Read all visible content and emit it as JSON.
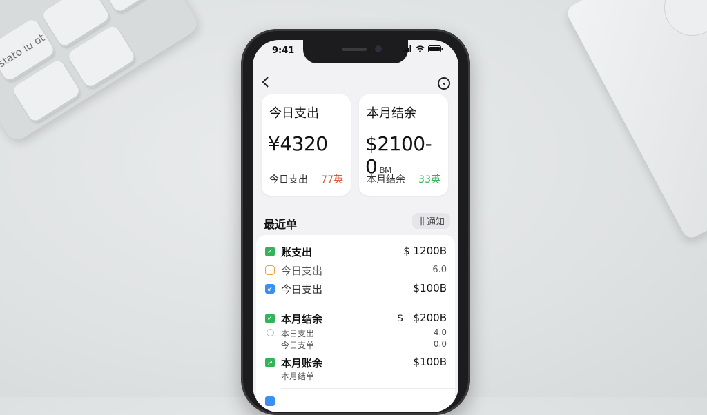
{
  "background": {
    "keyboard_keys": [
      "stato iu ot",
      "",
      ""
    ]
  },
  "status_bar": {
    "time": "9:41"
  },
  "header": {
    "back_icon": "chevron-left-icon",
    "more_icon": "more-circle-icon"
  },
  "cards": [
    {
      "label": "今日支出",
      "amount": "¥4320",
      "amount_suffix": "",
      "sub_label": "今日支出",
      "delta": "77英",
      "delta_color": "#e0573f"
    },
    {
      "label": "本月结余",
      "amount": "$2100-0",
      "amount_suffix": "BM",
      "sub_label": "本月结余",
      "delta": "33英",
      "delta_color": "#34b45a"
    }
  ],
  "recent": {
    "title": "最近单",
    "filter": "非通知",
    "rows": [
      {
        "icon": "check-icon",
        "icon_color": "#34b45a",
        "text": "账支出",
        "value": "$ 1200B",
        "size": "large",
        "bold": true
      },
      {
        "icon": "clock-icon",
        "icon_color": "#f0a23b",
        "text": "今日支出",
        "value": "6.0",
        "size": "large",
        "bold": false
      },
      {
        "icon": "arrow-icon",
        "icon_color": "#3b8ff0",
        "text": "今日支出",
        "value": "$100B",
        "size": "large",
        "bold": false
      },
      {
        "icon": "check-icon",
        "icon_color": "#34b45a",
        "text": "本月结余",
        "value": "$   $200B",
        "size": "large",
        "bold": true
      },
      {
        "icon": "circle-icon",
        "icon_color": "#9ad6a8",
        "text": "本日支出",
        "value": "4.0",
        "size": "small",
        "bold": false
      },
      {
        "icon": "",
        "icon_color": "",
        "text": "今日支单",
        "value": "0.0",
        "size": "small",
        "bold": false
      },
      {
        "icon": "chart-icon",
        "icon_color": "#34b45a",
        "text": "本月账余",
        "value": "$100B",
        "size": "large",
        "bold": true
      },
      {
        "icon": "",
        "icon_color": "",
        "text": "本月结单",
        "value": "",
        "size": "small",
        "bold": false
      }
    ]
  }
}
